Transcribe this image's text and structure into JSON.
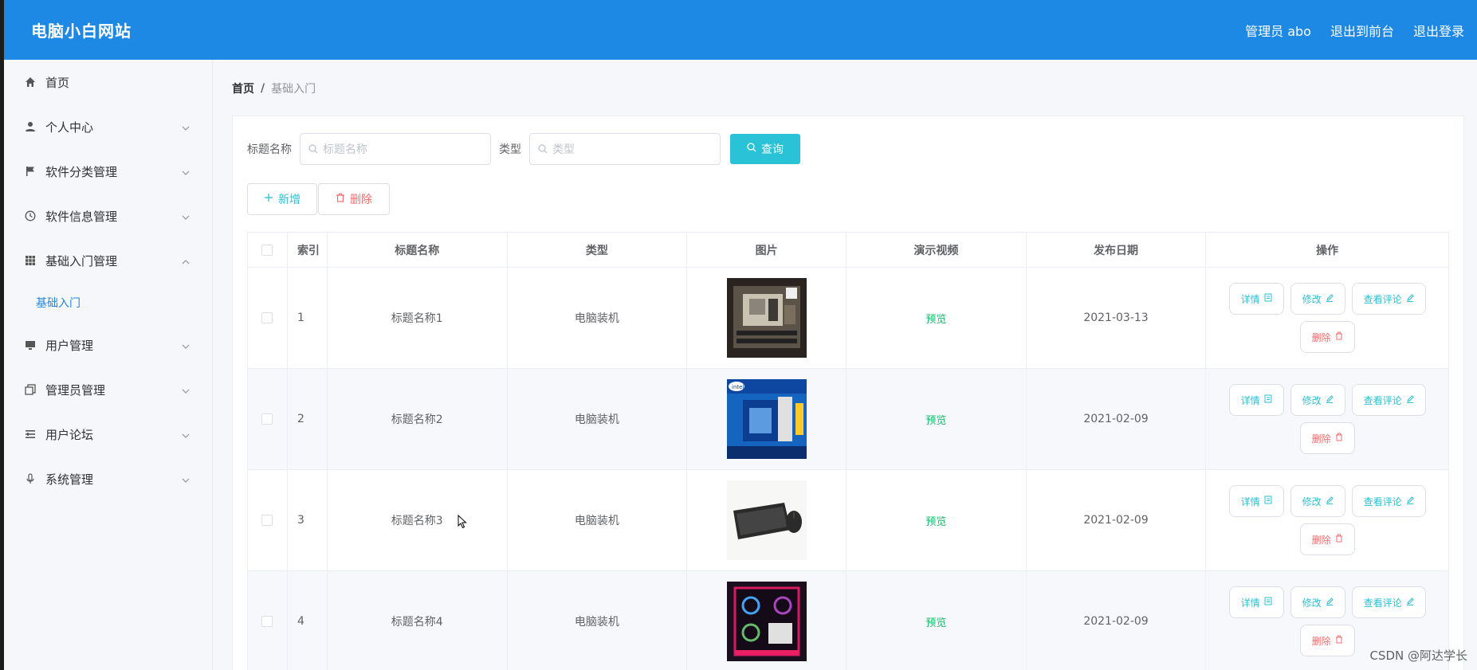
{
  "header": {
    "brand": "电脑小白网站",
    "admin": "管理员 abo",
    "back_front": "退出到前台",
    "logout": "退出登录"
  },
  "sidebar": {
    "items": [
      {
        "label": "首页",
        "icon": "home-icon"
      },
      {
        "label": "个人中心",
        "icon": "user-icon",
        "arrow": "down"
      },
      {
        "label": "软件分类管理",
        "icon": "flag-icon",
        "arrow": "down"
      },
      {
        "label": "软件信息管理",
        "icon": "clock-icon",
        "arrow": "down"
      },
      {
        "label": "基础入门管理",
        "icon": "grid-icon",
        "arrow": "up"
      },
      {
        "label": "用户管理",
        "icon": "monitor-icon",
        "arrow": "down"
      },
      {
        "label": "管理员管理",
        "icon": "copy-icon",
        "arrow": "down"
      },
      {
        "label": "用户论坛",
        "icon": "list-icon",
        "arrow": "down"
      },
      {
        "label": "系统管理",
        "icon": "mic-icon",
        "arrow": "down"
      }
    ],
    "submenu": {
      "label": "基础入门"
    }
  },
  "breadcrumb": {
    "home": "首页",
    "sep": "/",
    "current": "基础入门"
  },
  "search": {
    "title_label": "标题名称",
    "title_placeholder": "标题名称",
    "type_label": "类型",
    "type_placeholder": "类型",
    "button": "查询"
  },
  "actions": {
    "add": "新增",
    "delete": "删除"
  },
  "table": {
    "headers": {
      "index": "索引",
      "title": "标题名称",
      "type": "类型",
      "image": "图片",
      "video": "演示视频",
      "date": "发布日期",
      "ops": "操作"
    },
    "rows": [
      {
        "index": "1",
        "title": "标题名称1",
        "type": "电脑装机",
        "video": "预览",
        "date": "2021-03-13",
        "image": "motherboard-photo"
      },
      {
        "index": "2",
        "title": "标题名称2",
        "type": "电脑装机",
        "video": "预览",
        "date": "2021-02-09",
        "image": "intel-cpu-box-photo"
      },
      {
        "index": "3",
        "title": "标题名称3",
        "type": "电脑装机",
        "video": "预览",
        "date": "2021-02-09",
        "image": "keyboard-mouse-photo"
      },
      {
        "index": "4",
        "title": "标题名称4",
        "type": "电脑装机",
        "video": "预览",
        "date": "2021-02-09",
        "image": "rgb-case-photo"
      }
    ],
    "ops": {
      "detail": "详情",
      "edit": "修改",
      "comments": "查看评论",
      "delete": "删除"
    }
  },
  "watermark": "CSDN @阿达学长",
  "colors": {
    "header": "#1e88e5",
    "accent": "#29c2d6",
    "danger": "#f56c6c",
    "success": "#19be6b"
  }
}
